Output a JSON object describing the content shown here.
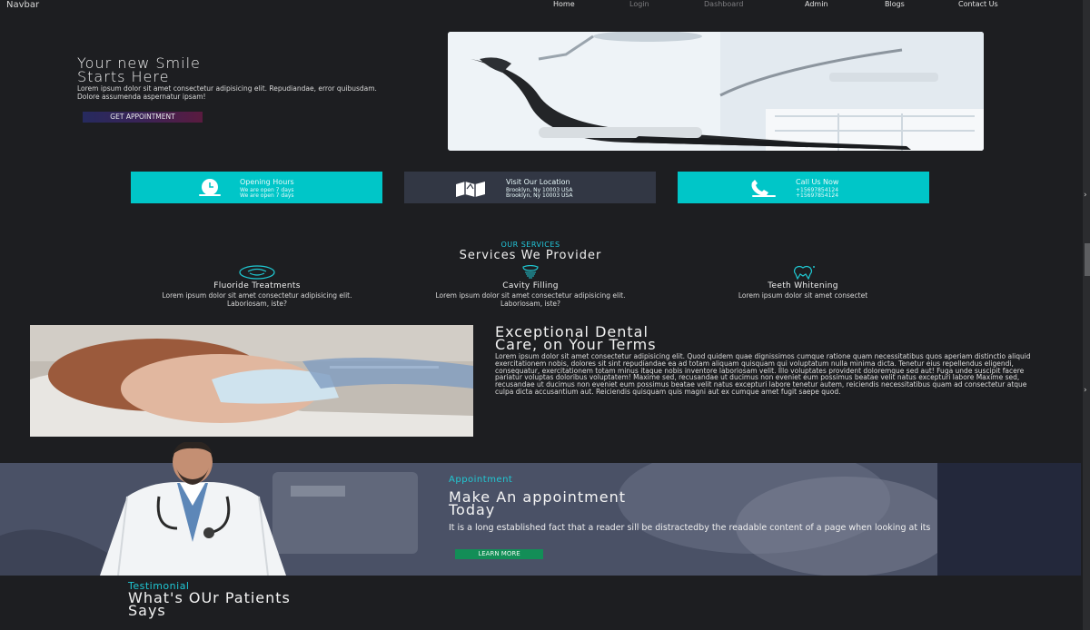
{
  "navbar": {
    "brand": "Navbar",
    "links": [
      "Home",
      "Login",
      "Dashboard",
      "Admin",
      "Blogs",
      "Contact Us"
    ]
  },
  "hero": {
    "title_line1": "Your new Smile",
    "title_line2": "Starts Here",
    "text": "Lorem ipsum dolor sit amet consectetur adipisicing elit. Repudiandae, error quibusdam. Dolore assumenda aspernatur ipsam!",
    "button": "GET APPOINTMENT"
  },
  "info_boxes": [
    {
      "title": "Opening Hours",
      "line1": "We are open 7 days",
      "line2": "We are open 7 days",
      "icon": "clock-icon"
    },
    {
      "title": "Visit Our Location",
      "line1": "Brooklyn, Ny 10003 USA",
      "line2": "Brooklyn, Ny 10003 USA",
      "icon": "map-icon"
    },
    {
      "title": "Call Us Now",
      "line1": "+15697854124",
      "line2": "+15697854124",
      "icon": "phone-icon"
    }
  ],
  "services": {
    "kicker": "OUR SERVICES",
    "title": "Services We Provider",
    "items": [
      {
        "name": "Fluoride Treatments",
        "text": "Lorem ipsum dolor sit amet consectetur adipisicing elit. Laboriosam, iste?"
      },
      {
        "name": "Cavity Filling",
        "text": "Lorem ipsum dolor sit amet consectetur adipisicing elit. Laboriosam, iste?"
      },
      {
        "name": "Teeth Whitening",
        "text": "Lorem ipsum dolor sit amet consectet"
      }
    ]
  },
  "exceptional": {
    "title_line1": "Exceptional Dental",
    "title_line2": "Care, on Your Terms",
    "text": "Lorem ipsum dolor sit amet consectetur adipisicing elit. Quod quidem quae dignissimos cumque ratione quam necessitatibus quos aperiam distinctio aliquid exercitationem nobis, dolores sit sint repudiandae ea ad totam aliquam quisquam qui voluptatum nulla minima dicta. Tenetur eius repellendus eligendi, consequatur, exercitationem totam minus itaque nobis inventore laboriosam velit. Illo voluptates provident doloremque sed aut! Fuga unde suscipit facere pariatur voluptas doloribus voluptatem! Maxime sed, recusandae ut ducimus non eveniet eum possimus beatae velit natus excepturi labore Maxime sed, recusandae ut ducimus non eveniet eum possimus beatae velit natus excepturi labore tenetur autem, reiciendis necessitatibus quam ad consectetur atque culpa dicta accusantium aut. Reiciendis quisquam quis magni aut ex cumque amet fugit saepe quod."
  },
  "appointment": {
    "kicker": "Appointment",
    "title_line1": "Make An appointment",
    "title_line2": "Today",
    "text": "It is a long established fact that a reader sill be distractedby the readable content of a page when looking at its",
    "button": "LEARN MORE"
  },
  "testimonial": {
    "kicker": "Testimonial",
    "title_line1": "What's OUr Patients",
    "title_line2": "Says"
  },
  "colors": {
    "background": "#1d1e21",
    "teal": "#00c6c8",
    "accent_cyan": "#21c8d3",
    "appointment_button": "#138e57"
  }
}
